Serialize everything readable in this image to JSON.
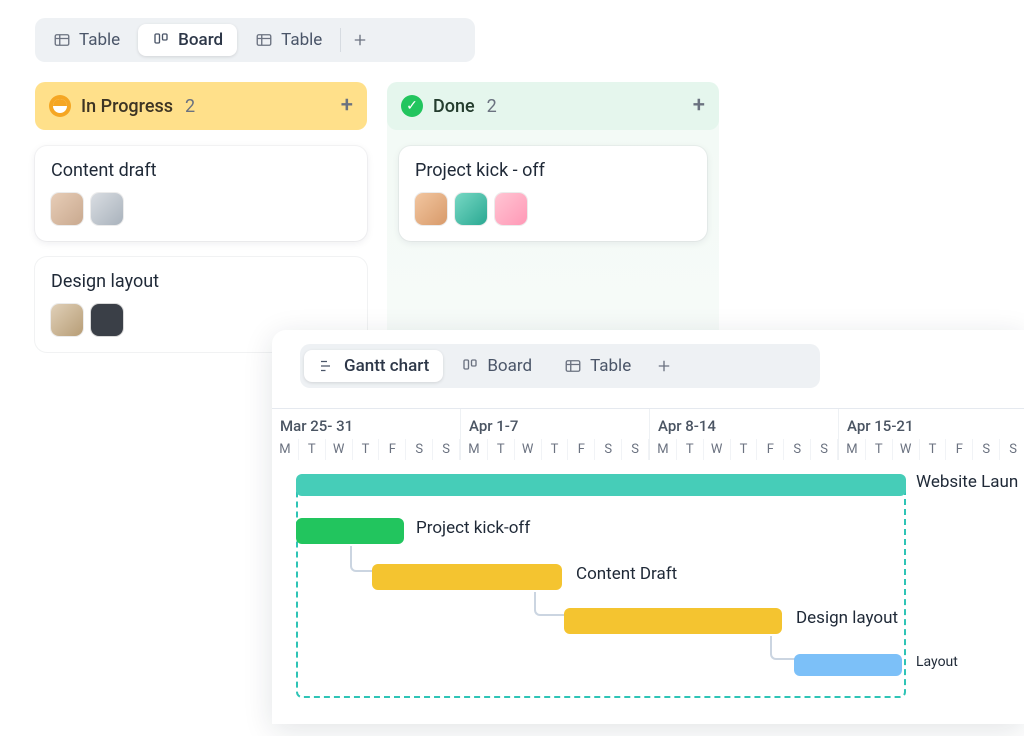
{
  "board_tabs": {
    "items": [
      {
        "label": "Table"
      },
      {
        "label": "Board"
      },
      {
        "label": "Table"
      }
    ],
    "active_index": 1
  },
  "columns": [
    {
      "key": "in_progress",
      "title": "In Progress",
      "count": "2",
      "cards": [
        {
          "title": "Content draft",
          "avatars": [
            "p1",
            "p2"
          ]
        },
        {
          "title": "Design layout",
          "avatars": [
            "p6",
            "p7"
          ]
        }
      ]
    },
    {
      "key": "done",
      "title": "Done",
      "count": "2",
      "cards": [
        {
          "title": "Project kick - off",
          "avatars": [
            "p3",
            "p4",
            "p5"
          ]
        }
      ]
    }
  ],
  "gantt_tabs": {
    "items": [
      {
        "label": "Gantt chart"
      },
      {
        "label": "Board"
      },
      {
        "label": "Table"
      }
    ],
    "active_index": 0
  },
  "gantt": {
    "week_ranges": [
      "Mar 25- 31",
      "Apr 1-7",
      "Apr 8-14",
      "Apr 15-21"
    ],
    "day_letters": [
      "M",
      "T",
      "W",
      "T",
      "F",
      "S",
      "S"
    ],
    "project_label": "Website Laun",
    "bars": [
      {
        "label": "Project kick-off"
      },
      {
        "label": "Content Draft"
      },
      {
        "label": "Design layout"
      },
      {
        "label": "Layout"
      }
    ]
  }
}
